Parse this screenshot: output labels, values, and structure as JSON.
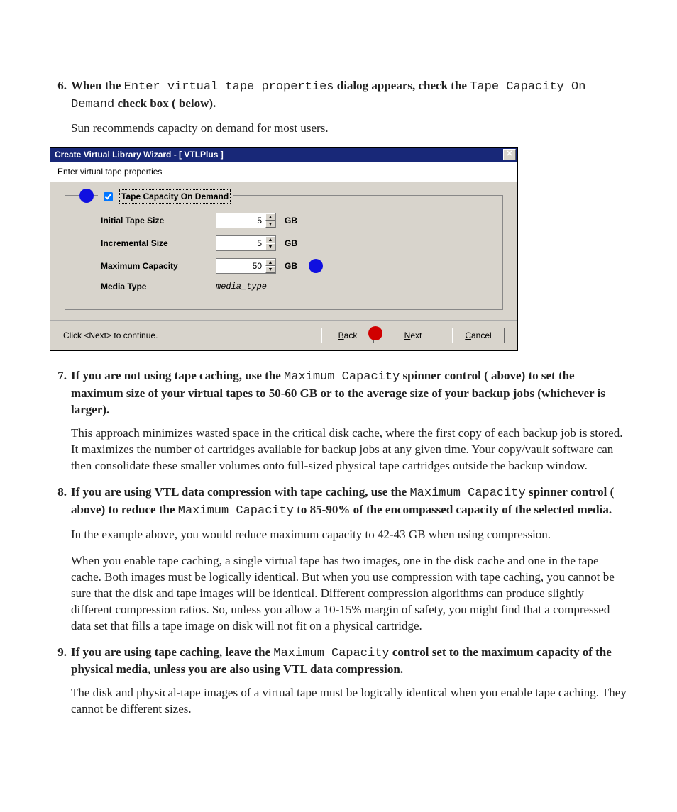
{
  "steps": {
    "s6": {
      "num": "6.",
      "lead_1": "When the ",
      "mono_1": "Enter virtual tape properties",
      "lead_2": " dialog appears, check the ",
      "mono_2": "Tape Capacity On Demand",
      "lead_3": " check box (   below).",
      "follow": "Sun recommends capacity on demand for most users."
    },
    "s7": {
      "num": "7.",
      "lead_1": "If you are not using tape caching, use the ",
      "mono_1": "Maximum Capacity",
      "lead_2": " spinner control (   above) to set the maximum size of your virtual tapes to 50-60 GB or to the average size of your backup jobs (whichever is larger).",
      "follow": "This approach minimizes wasted space in the critical disk cache, where the first copy of each backup job is stored. It maximizes the number of cartridges available for backup jobs at any given time. Your copy/vault software can then consolidate these smaller volumes onto full-sized physical tape cartridges outside the backup window."
    },
    "s8": {
      "num": "8.",
      "lead_1": "If you are using VTL data compression with tape caching, use the ",
      "mono_1": "Maximum Capacity",
      "lead_2": " spinner control (   above) to reduce the ",
      "mono_2": "Maximum Capacity",
      "lead_3": " to 85-90% of the encompassed capacity of the selected media.",
      "follow1": "In the example above, you would reduce maximum capacity to 42-43 GB when using compression.",
      "follow2": "When you enable tape caching, a single virtual tape has two images, one in the disk cache and one in the tape cache. Both images must be logically identical. But when you use compression with tape caching, you cannot be sure that the disk and tape images will be identical. Different compression algorithms can produce slightly different compression ratios. So, unless you allow a 10-15% margin of safety, you might find that a compressed data set that fills a tape image on disk will not fit on a physical cartridge."
    },
    "s9": {
      "num": "9.",
      "lead_1": "If you are using tape caching, leave the ",
      "mono_1": "Maximum Capacity",
      "lead_2": " control set to the maximum capacity of the physical media, unless you are also using VTL data compression.",
      "follow": "The disk and physical-tape images of a virtual tape must be logically identical when you enable tape caching. They cannot be different sizes."
    }
  },
  "dialog": {
    "title": "Create Virtual Library Wizard - [ VTLPlus ]",
    "subtitle": "Enter virtual tape properties",
    "legend": "Tape Capacity On Demand",
    "checkbox_checked": true,
    "labels": {
      "initial": "Initial Tape Size",
      "incremental": "Incremental Size",
      "maxcap": "Maximum Capacity",
      "mediatype": "Media Type"
    },
    "values": {
      "initial": "5",
      "incremental": "5",
      "maxcap": "50",
      "mediatype": "media_type"
    },
    "unit": "GB",
    "hint": "Click <Next> to continue.",
    "buttons": {
      "back": "Back",
      "next": "Next",
      "cancel": "Cancel"
    },
    "colors": {
      "callout_blue": "#1010e0",
      "callout_red": "#d00000",
      "titlebar": "#182878"
    }
  }
}
